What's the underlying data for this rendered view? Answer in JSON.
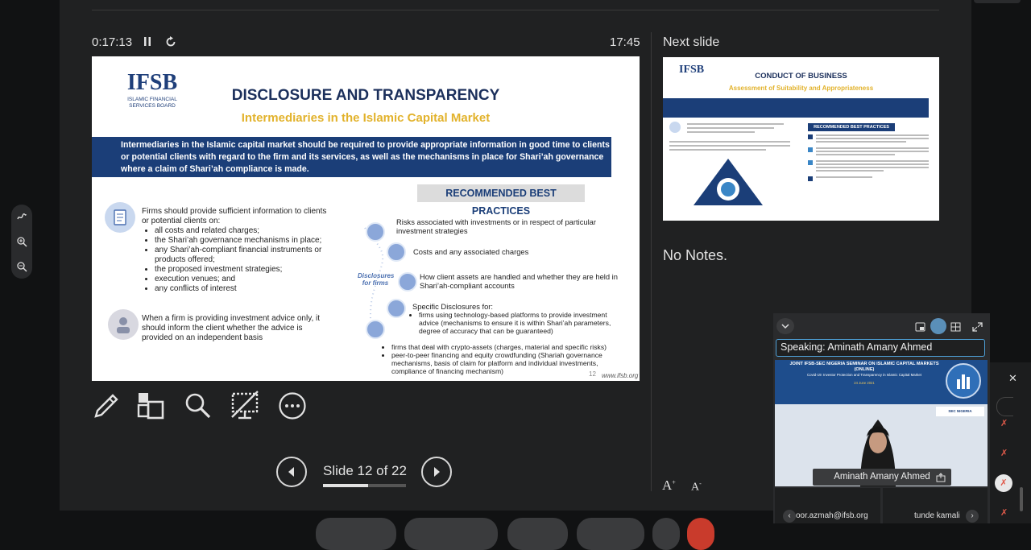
{
  "presenter": {
    "elapsed_time": "0:17:13",
    "clock": "17:45",
    "next_slide_label": "Next slide",
    "notes": "No Notes.",
    "slide_counter": "Slide 12 of 22",
    "progress_fraction": 0.545
  },
  "slide": {
    "logo_text": "IFSB",
    "logo_subtitle": "ISLAMIC FINANCIAL SERVICES BOARD",
    "title": "DISCLOSURE AND TRANSPARENCY",
    "subtitle": "Intermediaries in the Islamic Capital Market",
    "intro": "Intermediaries in the Islamic capital market should be required to provide appropriate information in good time to clients or potential clients with regard to the firm and its services, as well as the mechanisms in place for Shari’ah governance where a claim of Shari’ah compliance is made.",
    "recommended": "RECOMMENDED BEST PRACTICES",
    "left_lead": "Firms should provide sufficient information to clients or potential clients on:",
    "left_items": [
      "all costs and related charges;",
      "the Shari’ah governance mechanisms in place;",
      "any Shari’ah-compliant financial instruments or products offered;",
      "the proposed investment strategies;",
      "execution venues; and",
      "any conflicts of interest"
    ],
    "left_advice": "When a firm is providing investment advice only, it should inform the client whether the advice is provided on an independent basis",
    "disclosures_label": "Disclosures for firms",
    "right_items": [
      "Risks associated with investments or in respect of particular investment strategies",
      "Costs and any associated charges",
      "How client assets are handled and whether they are held in Shari’ah-compliant accounts",
      "Specific Disclosures for:"
    ],
    "specific_items": [
      "firms using technology-based platforms to provide investment advice (mechanisms to ensure it is within Shari’ah parameters, degree of accuracy that can be guaranteed)",
      "firms that deal with crypto-assets (charges, material and specific risks)",
      "peer-to-peer financing and equity crowdfunding (Shariah governance mechanisms, basis of claim for platform and individual investments, compliance of financing mechanism)"
    ],
    "page_number": "12",
    "url": "www.ifsb.org"
  },
  "next_slide": {
    "logo_text": "IFSB",
    "title": "CONDUCT OF BUSINESS",
    "subtitle": "Assessment of Suitability and Appropriateness",
    "recommended": "RECOMMENDED BEST PRACTICES"
  },
  "video": {
    "speaking_label": "Speaking:",
    "speaker": "Aminath Amany Ahmed",
    "banner_title": "JOINT IFSB-SEC NIGERIA SEMINAR ON ISLAMIC CAPITAL MARKETS (ONLINE)",
    "banner_subtitle": "Covid-19: Investor Protection and Transparency in Islamic Capital Market",
    "banner_date": "24 June 2021",
    "org_logo": "SEC NIGERIA",
    "name_tag": "Aminath Amany Ahmed",
    "participants": [
      "oor.azmah@ifsb.org",
      "tunde kamali"
    ]
  },
  "icons": [
    "pause-icon",
    "restart-icon",
    "pen-icon",
    "slides-grid-icon",
    "zoom-icon",
    "screen-off-icon",
    "more-icon",
    "prev-slide-icon",
    "next-slide-icon",
    "font-increase-icon",
    "font-decrease-icon",
    "collapse-icon",
    "pip-icon",
    "gallery-icon",
    "expand-icon",
    "close-icon",
    "mic-off-icon",
    "share-icon"
  ],
  "colors": {
    "slide_navy": "#1b3e78",
    "slide_gold": "#e2b22b",
    "speaking_border": "#4ea0d8",
    "mic_off": "#e05a4a"
  }
}
